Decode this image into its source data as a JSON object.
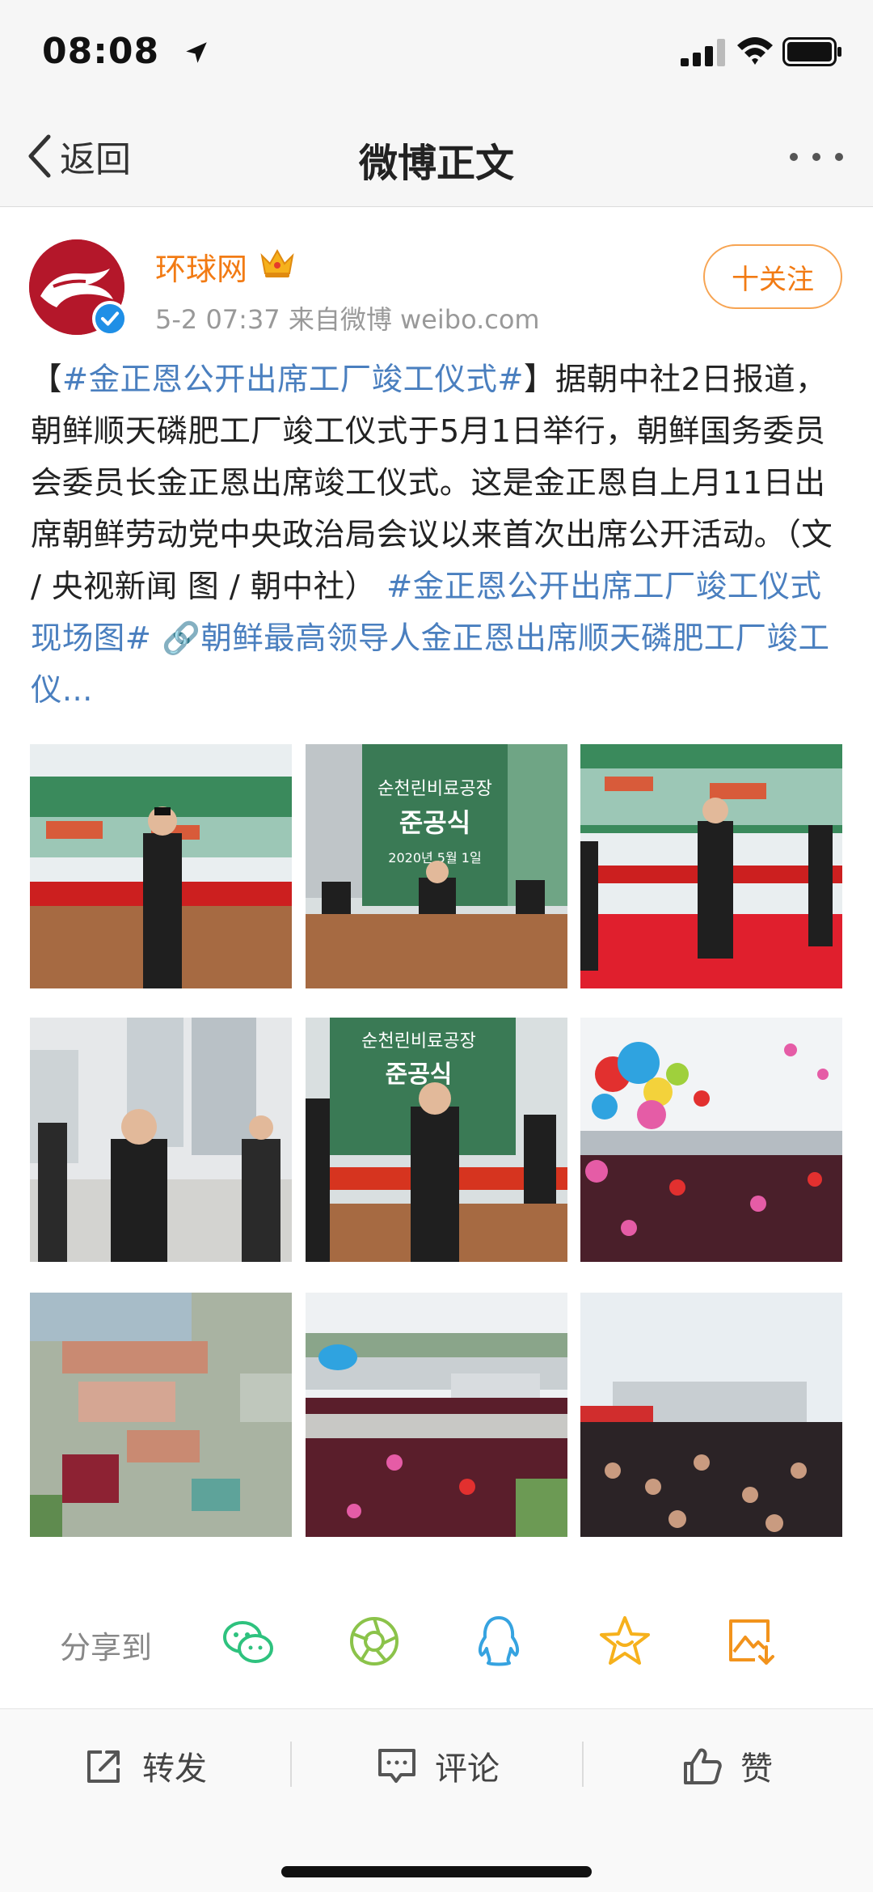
{
  "status_bar": {
    "time": "08:08"
  },
  "nav": {
    "back_label": "返回",
    "title": "微博正文"
  },
  "post": {
    "author": "环球网",
    "meta": "5-2 07:37  来自微博 weibo.com",
    "follow_label": "十关注",
    "text_parts": [
      {
        "text": "【",
        "tag": false
      },
      {
        "text": "#金正恩公开出席工厂竣工仪式#",
        "tag": true
      },
      {
        "text": "】据朝中社2日报道，朝鲜顺天磷肥工厂竣工仪式于5月1日举行，朝鲜国务委员会委员长金正恩出席竣工仪式。这是金正恩自上月11日出席朝鲜劳动党中央政治局会议以来首次出席公开活动。（文 / 央视新闻 图 / 朝中社） ",
        "tag": false
      },
      {
        "text": "#金正恩公开出席工厂竣工仪式现场图#",
        "tag": true
      },
      {
        "text": " ",
        "tag": false
      },
      {
        "text": "🔗朝鲜最高领导人金正恩出席顺天磷肥工厂竣工仪...",
        "tag": true
      }
    ],
    "image_sign_lines": [
      "순천린비료공장",
      "준공식",
      "2020년 5월 1일"
    ]
  },
  "share": {
    "label": "分享到"
  },
  "actions": {
    "repost": "转发",
    "comment": "评论",
    "like": "赞"
  },
  "colors": {
    "accent_orange": "#f27b14",
    "link_blue": "#4a7fbf",
    "verified_blue": "#1f8fe6"
  }
}
